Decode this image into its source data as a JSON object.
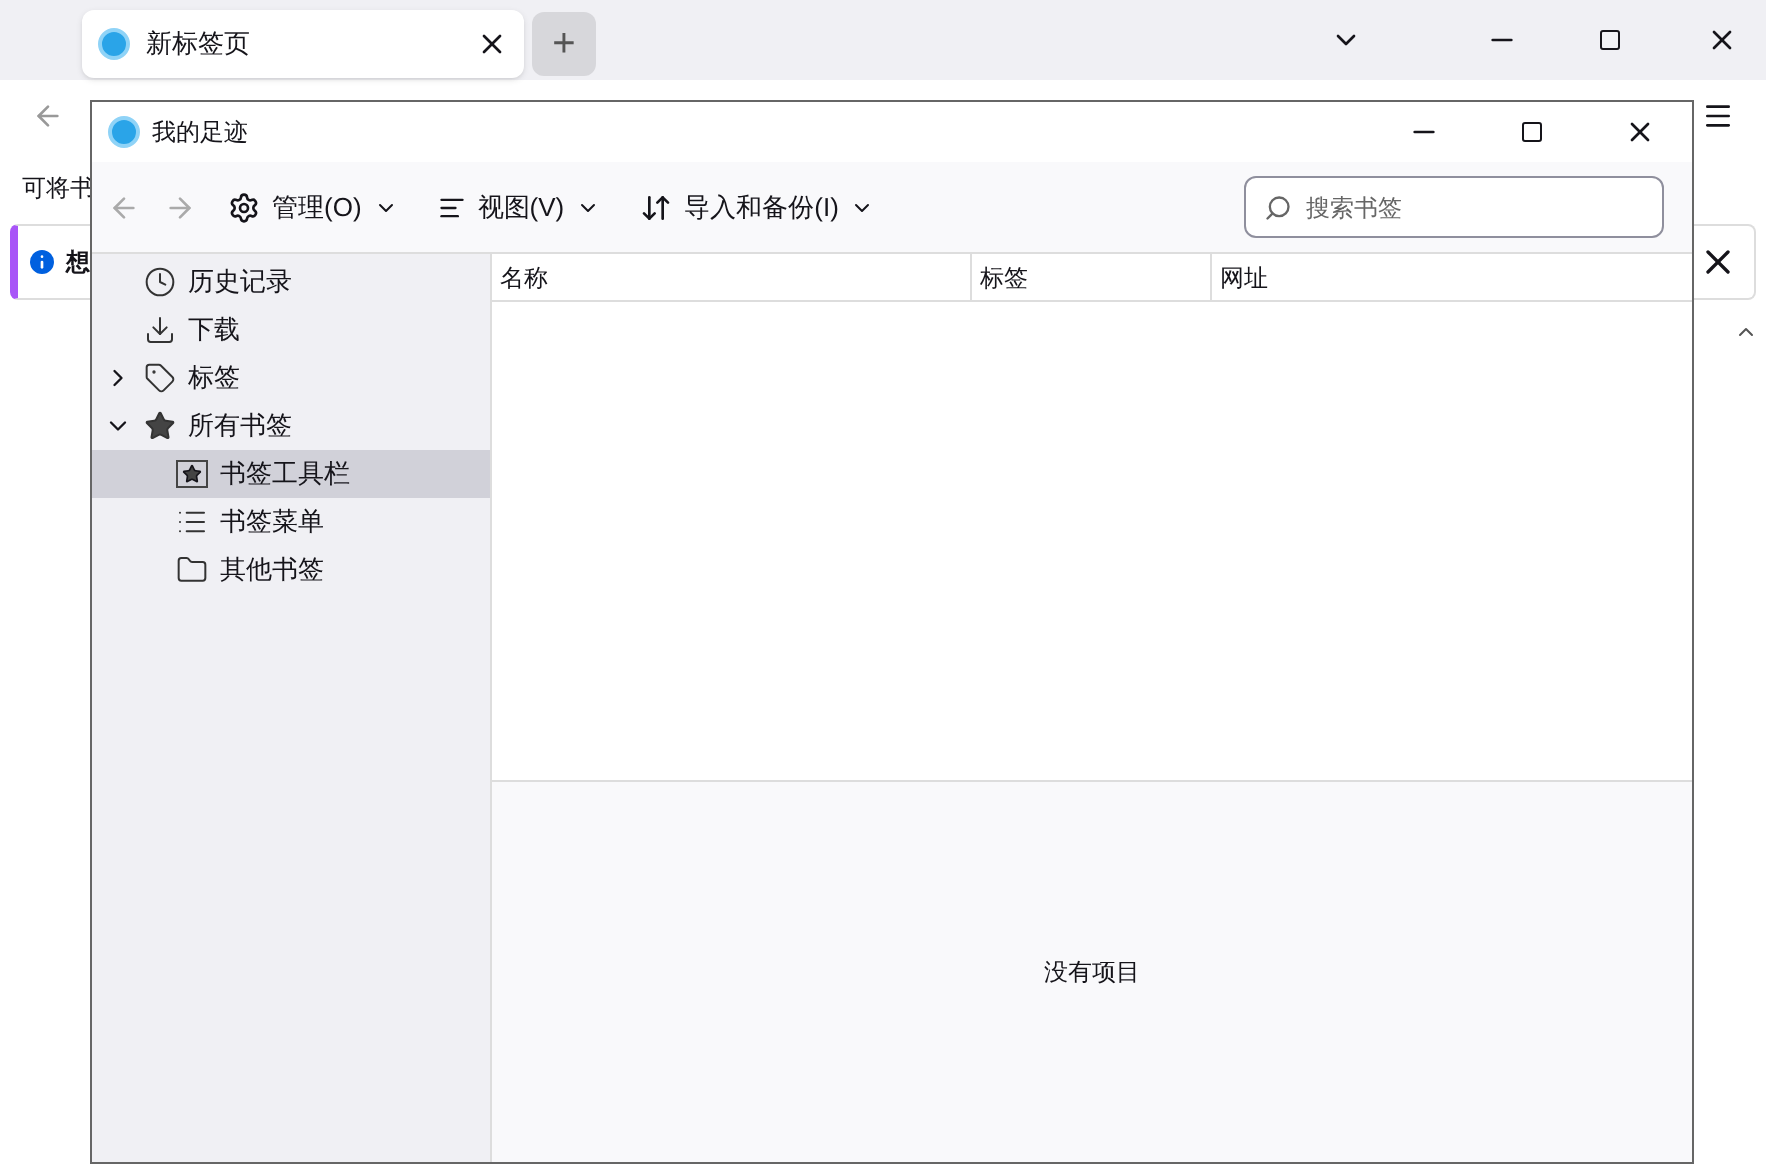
{
  "browser": {
    "tab": {
      "title": "新标签页"
    },
    "new_tab_button": "+",
    "bookmarks_bar_text": "可将书",
    "notification": {
      "text": "想"
    }
  },
  "dialog": {
    "title": "我的足迹",
    "toolbar": [
      {
        "kind": "manage",
        "label": "管理(O)"
      },
      {
        "kind": "view",
        "label": "视图(V)"
      },
      {
        "kind": "import",
        "label": "导入和备份(I)"
      }
    ],
    "search": {
      "placeholder": "搜索书签"
    },
    "sidebar": {
      "items": [
        {
          "kind": "history",
          "label": "历史记录",
          "selected": false
        },
        {
          "kind": "downloads",
          "label": "下载",
          "selected": false
        },
        {
          "kind": "tags",
          "label": "标签",
          "selected": false,
          "expanded": false
        },
        {
          "kind": "all",
          "label": "所有书签",
          "selected": false,
          "expanded": true,
          "children": [
            {
              "kind": "toolbar",
              "label": "书签工具栏",
              "selected": true
            },
            {
              "kind": "menu",
              "label": "书签菜单",
              "selected": false
            },
            {
              "kind": "folder",
              "label": "其他书签",
              "selected": false
            }
          ]
        }
      ]
    },
    "table": {
      "columns": [
        "名称",
        "标签",
        "网址"
      ]
    },
    "details": {
      "empty_text": "没有项目"
    }
  }
}
